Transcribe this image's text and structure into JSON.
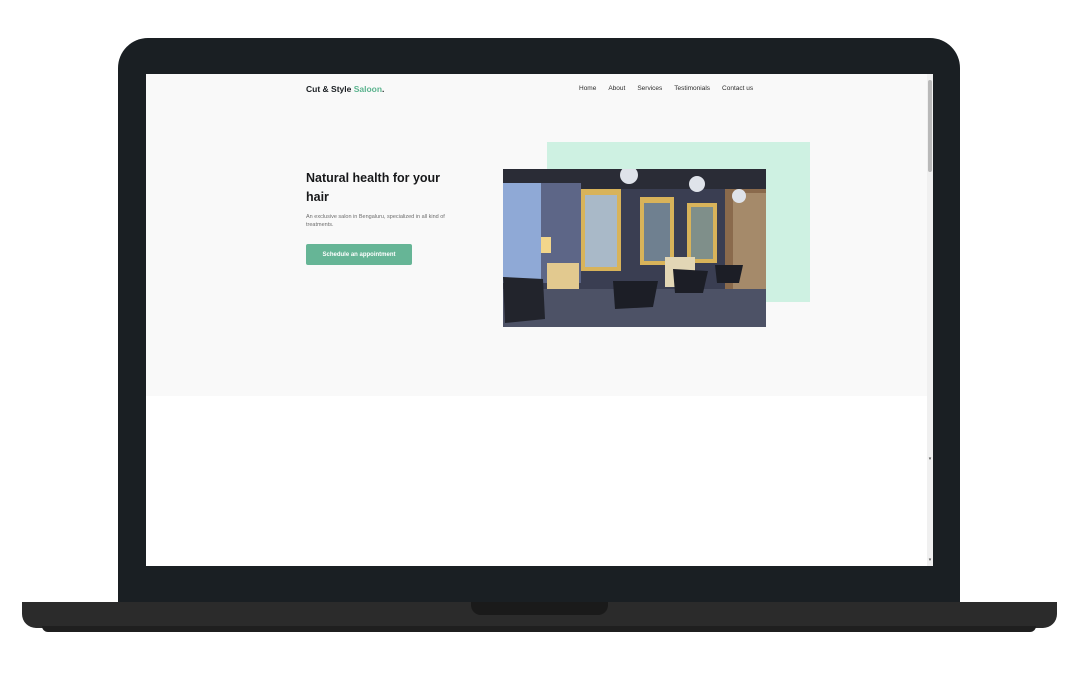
{
  "site": {
    "brand_main": "Cut & Style ",
    "brand_accent": "Saloon",
    "brand_dot": "."
  },
  "nav": {
    "items": [
      {
        "label": "Home"
      },
      {
        "label": "About"
      },
      {
        "label": "Services"
      },
      {
        "label": "Testimonials"
      },
      {
        "label": "Contact us"
      }
    ]
  },
  "hero": {
    "title": "Natural health for your hair",
    "subtitle": "An exclusive salon in Bengaluru, specialized in all kind of treatments.",
    "cta_label": "Schedule an appointment"
  },
  "colors": {
    "accent": "#5bb38e",
    "button": "#66b596",
    "mint_block": "#cef1e2",
    "laptop_frame": "#1a1f23"
  }
}
